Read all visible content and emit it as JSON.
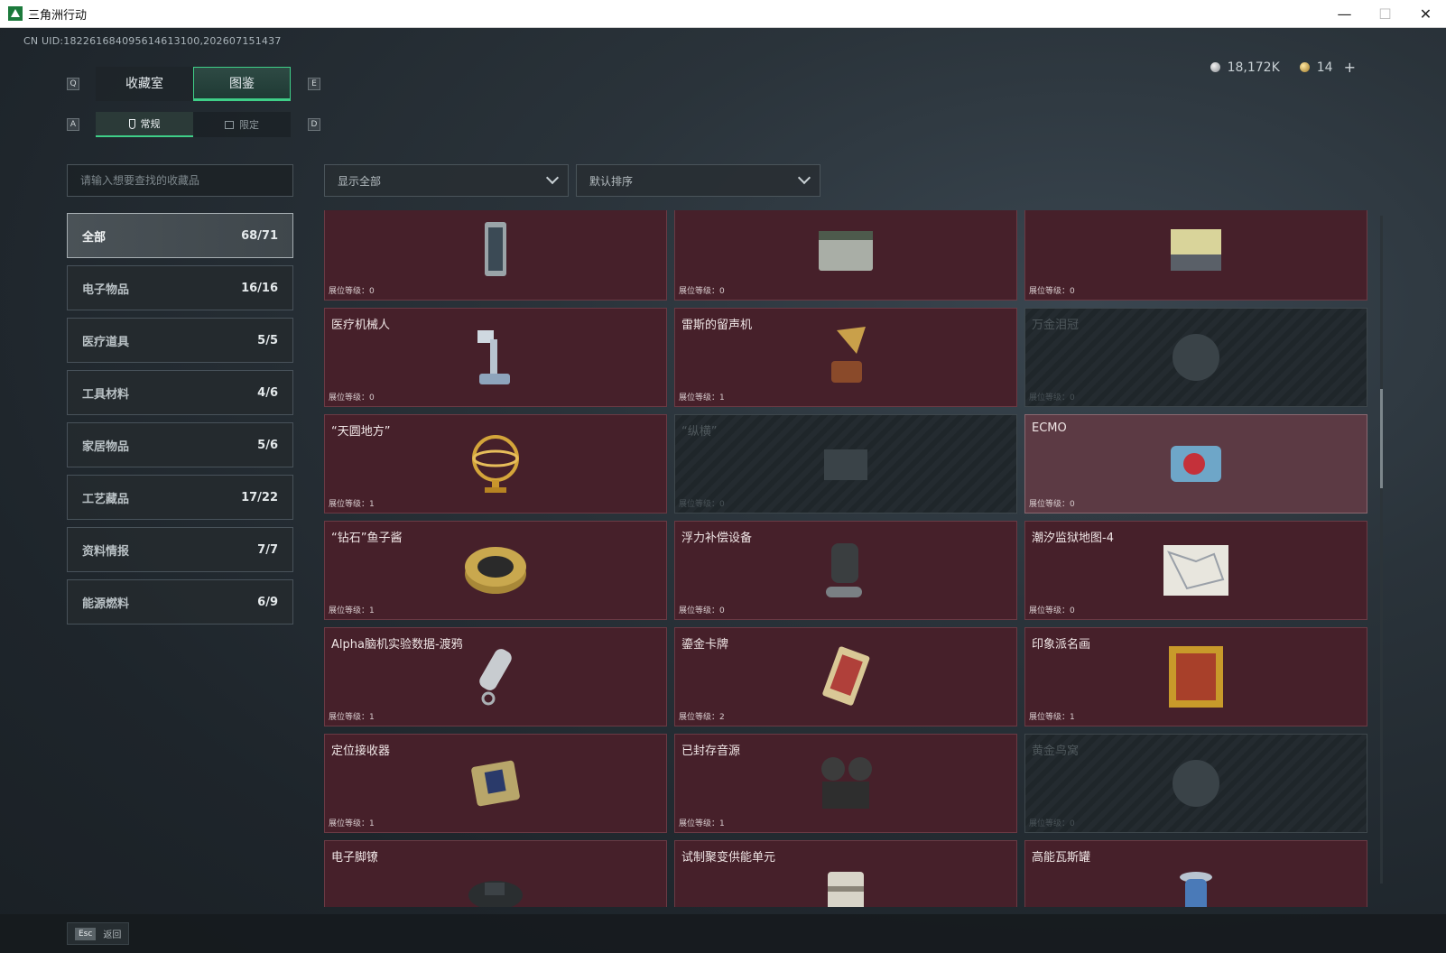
{
  "window": {
    "title": "三角洲行动",
    "minimize_icon": "minimize-icon",
    "maximize_icon": "maximize-icon",
    "close_icon": "close-icon",
    "minimize_glyph": "—",
    "maximize_glyph": "☐",
    "close_glyph": "✕"
  },
  "header": {
    "uid": "CN UID:18226168409561461310​0,202607151437",
    "silver_amount": "18,172K",
    "gold_amount": "14",
    "plus_label": "+"
  },
  "tabs": {
    "key_left": "Q",
    "key_right": "E",
    "items": [
      {
        "label": "收藏室"
      },
      {
        "label": "图鉴"
      }
    ]
  },
  "subtabs": {
    "key_left": "A",
    "key_right": "D",
    "items": [
      {
        "label": "常规",
        "icon": "flask-icon"
      },
      {
        "label": "限定",
        "icon": "picture-icon"
      }
    ]
  },
  "search": {
    "placeholder": "请输入想要查找的收藏品"
  },
  "filters": {
    "display": "显示全部",
    "sort": "默认排序"
  },
  "categories": [
    {
      "label": "全部",
      "count": "68/71"
    },
    {
      "label": "电子物品",
      "count": "16/16"
    },
    {
      "label": "医疗道具",
      "count": "5/5"
    },
    {
      "label": "工具材料",
      "count": "4/6"
    },
    {
      "label": "家居物品",
      "count": "5/6"
    },
    {
      "label": "工艺藏品",
      "count": "17/22"
    },
    {
      "label": "资料情报",
      "count": "7/7"
    },
    {
      "label": "能源燃料",
      "count": "6/9"
    }
  ],
  "items": [
    {
      "name": "",
      "level": "展位等级：0",
      "state": "owned",
      "icon": "reactor-icon"
    },
    {
      "name": "",
      "level": "展位等级：0",
      "state": "owned",
      "icon": "crate-icon"
    },
    {
      "name": "",
      "level": "展位等级：0",
      "state": "owned",
      "icon": "battery-pack-icon"
    },
    {
      "name": "医疗机械人",
      "level": "展位等级：0",
      "state": "owned",
      "icon": "medical-robot-icon"
    },
    {
      "name": "雷斯的留声机",
      "level": "展位等级：1",
      "state": "owned",
      "icon": "gramophone-icon"
    },
    {
      "name": "万金泪冠",
      "level": "展位等级：0",
      "state": "locked",
      "icon": "crown-icon"
    },
    {
      "name": "“天圆地方”",
      "level": "展位等级：1",
      "state": "owned",
      "icon": "armillary-sphere-icon"
    },
    {
      "name": "“纵横”",
      "level": "展位等级：0",
      "state": "locked",
      "icon": "board-icon"
    },
    {
      "name": "ECMO",
      "level": "展位等级：0",
      "state": "highlight",
      "icon": "ecmo-icon"
    },
    {
      "name": "“钻石”鱼子酱",
      "level": "展位等级：1",
      "state": "owned",
      "icon": "caviar-tin-icon"
    },
    {
      "name": "浮力补偿设备",
      "level": "展位等级：0",
      "state": "owned",
      "icon": "diving-gear-icon"
    },
    {
      "name": "潮汐监狱地图-4",
      "level": "展位等级：0",
      "state": "owned",
      "icon": "map-icon"
    },
    {
      "name": "Alpha脑机实验数据-渡鸦",
      "level": "展位等级：1",
      "state": "owned",
      "icon": "data-canister-icon"
    },
    {
      "name": "鎏金卡牌",
      "level": "展位等级：2",
      "state": "owned",
      "icon": "card-icon"
    },
    {
      "name": "印象派名画",
      "level": "展位等级：1",
      "state": "owned",
      "icon": "painting-icon"
    },
    {
      "name": "定位接收器",
      "level": "展位等级：1",
      "state": "owned",
      "icon": "receiver-icon"
    },
    {
      "name": "已封存音源",
      "level": "展位等级：1",
      "state": "owned",
      "icon": "reel-recorder-icon"
    },
    {
      "name": "黄金鸟窝",
      "level": "展位等级：0",
      "state": "locked",
      "icon": "nest-icon"
    },
    {
      "name": "电子脚镣",
      "level": "",
      "state": "owned",
      "icon": "ankle-monitor-icon"
    },
    {
      "name": "试制聚变供能单元",
      "level": "",
      "state": "owned",
      "icon": "fusion-unit-icon"
    },
    {
      "name": "高能瓦斯罐",
      "level": "",
      "state": "owned",
      "icon": "gas-canister-icon"
    }
  ],
  "footer": {
    "esc_key": "Esc",
    "back_label": "返回"
  },
  "colors": {
    "accent": "#3fcf88",
    "card_owned": "#46202a",
    "card_highlight": "#5c3a44",
    "card_locked": "#242b30"
  }
}
